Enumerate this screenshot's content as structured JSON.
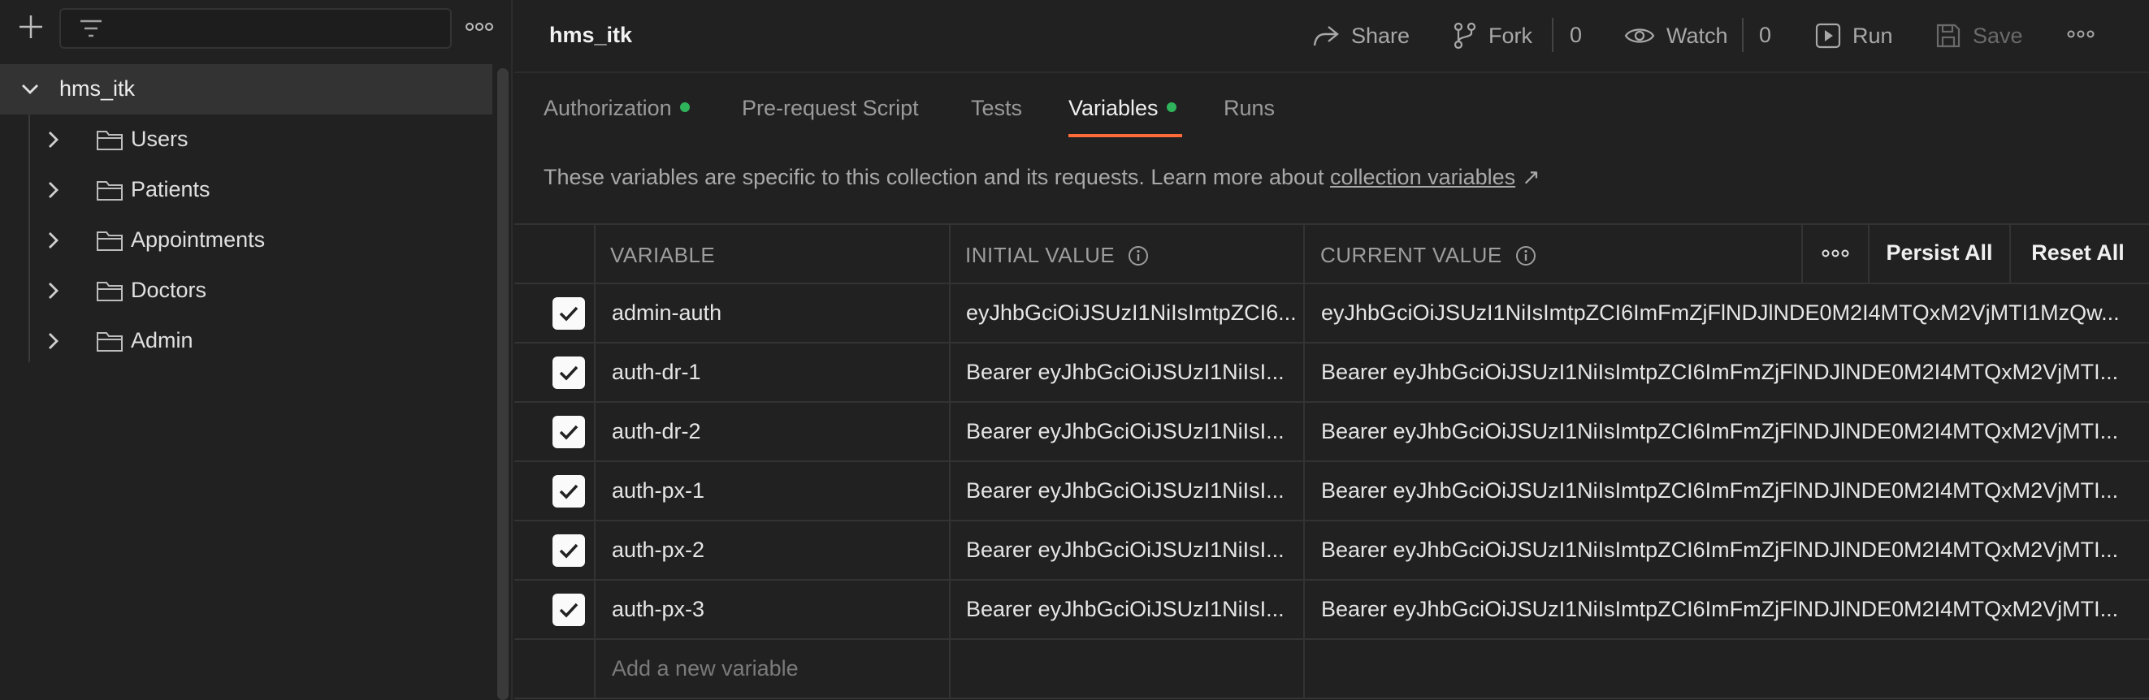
{
  "sidebar": {
    "root": {
      "label": "hms_itk"
    },
    "folders": [
      {
        "label": "Users"
      },
      {
        "label": "Patients"
      },
      {
        "label": "Appointments"
      },
      {
        "label": "Doctors"
      },
      {
        "label": "Admin"
      }
    ],
    "icons": {
      "new": "plus-icon",
      "filter": "filter-icon",
      "more": "more-icon",
      "expand": "chevron-right-icon",
      "collapse": "chevron-down-icon",
      "folder": "folder-icon"
    }
  },
  "header": {
    "title": "hms_itk",
    "share_label": "Share",
    "fork_label": "Fork",
    "fork_count": "0",
    "watch_label": "Watch",
    "watch_count": "0",
    "run_label": "Run",
    "save_label": "Save"
  },
  "tabs": [
    {
      "label": "Authorization",
      "has_dot": true
    },
    {
      "label": "Pre-request Script",
      "has_dot": false
    },
    {
      "label": "Tests",
      "has_dot": false
    },
    {
      "label": "Variables",
      "has_dot": true,
      "active": true
    },
    {
      "label": "Runs",
      "has_dot": false
    }
  ],
  "description": {
    "text": "These variables are specific to this collection and its requests. Learn more about",
    "link": "collection variables",
    "link_suffix": "↗"
  },
  "table": {
    "headers": {
      "variable": "VARIABLE",
      "initial": "INITIAL VALUE",
      "current": "CURRENT VALUE"
    },
    "persist_all_label": "Persist All",
    "reset_all_label": "Reset All",
    "rows": [
      {
        "checked": true,
        "variable": "admin-auth",
        "initial": "eyJhbGciOiJSUzI1NiIsImtpZCI6...",
        "current": "eyJhbGciOiJSUzI1NiIsImtpZCI6ImFmZjFlNDJlNDE0M2I4MTQxM2VjMTI1MzQw..."
      },
      {
        "checked": true,
        "variable": "auth-dr-1",
        "initial": "Bearer eyJhbGciOiJSUzI1NiIsI...",
        "current": "Bearer eyJhbGciOiJSUzI1NiIsImtpZCI6ImFmZjFlNDJlNDE0M2I4MTQxM2VjMTI..."
      },
      {
        "checked": true,
        "variable": "auth-dr-2",
        "initial": "Bearer eyJhbGciOiJSUzI1NiIsI...",
        "current": "Bearer eyJhbGciOiJSUzI1NiIsImtpZCI6ImFmZjFlNDJlNDE0M2I4MTQxM2VjMTI..."
      },
      {
        "checked": true,
        "variable": "auth-px-1",
        "initial": "Bearer eyJhbGciOiJSUzI1NiIsI...",
        "current": "Bearer eyJhbGciOiJSUzI1NiIsImtpZCI6ImFmZjFlNDJlNDE0M2I4MTQxM2VjMTI..."
      },
      {
        "checked": true,
        "variable": "auth-px-2",
        "initial": "Bearer eyJhbGciOiJSUzI1NiIsI...",
        "current": "Bearer eyJhbGciOiJSUzI1NiIsImtpZCI6ImFmZjFlNDJlNDE0M2I4MTQxM2VjMTI..."
      },
      {
        "checked": true,
        "variable": "auth-px-3",
        "initial": "Bearer eyJhbGciOiJSUzI1NiIsI...",
        "current": "Bearer eyJhbGciOiJSUzI1NiIsImtpZCI6ImFmZjFlNDJlNDE0M2I4MTQxM2VjMTI..."
      }
    ],
    "new_variable_placeholder": "Add a new variable"
  },
  "colors": {
    "background": "#212121",
    "accent": "#ff6c37",
    "status_dot": "#2fb35b",
    "selected_row": "#333333"
  }
}
